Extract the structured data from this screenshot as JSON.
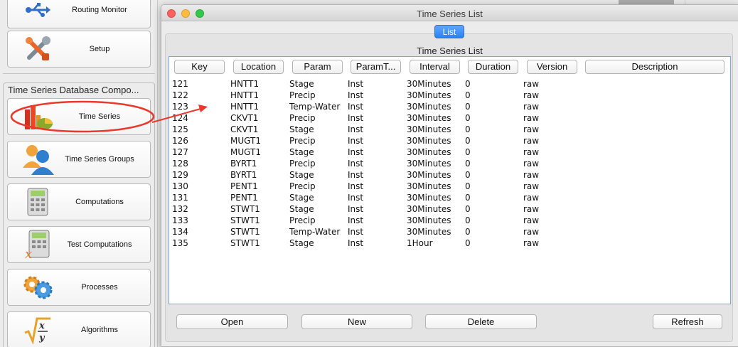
{
  "launcher": {
    "top_buttons": [
      {
        "label": "Routing Monitor",
        "icon": "usb-routing-icon"
      },
      {
        "label": "Setup",
        "icon": "tools-icon"
      }
    ],
    "group_title": "Time Series Database Compo...",
    "group_buttons": [
      {
        "label": "Time Series",
        "icon": "time-series-chart-icon"
      },
      {
        "label": "Time Series Groups",
        "icon": "users-group-icon"
      },
      {
        "label": "Computations",
        "icon": "calculator-icon"
      },
      {
        "label": "Test Computations",
        "icon": "test-calculator-icon"
      },
      {
        "label": "Processes",
        "icon": "gears-icon"
      },
      {
        "label": "Algorithms",
        "icon": "sqrt-formula-icon"
      }
    ]
  },
  "window": {
    "title": "Time Series List",
    "tab_label": "List",
    "panel_title": "Time Series List"
  },
  "table": {
    "columns": [
      "Key",
      "Location",
      "Param",
      "ParamT...",
      "Interval",
      "Duration",
      "Version",
      "Description"
    ],
    "rows": [
      [
        "121",
        "HNTT1",
        "Stage",
        "Inst",
        "30Minutes",
        "0",
        "raw",
        ""
      ],
      [
        "122",
        "HNTT1",
        "Precip",
        "Inst",
        "30Minutes",
        "0",
        "raw",
        ""
      ],
      [
        "123",
        "HNTT1",
        "Temp-Water",
        "Inst",
        "30Minutes",
        "0",
        "raw",
        ""
      ],
      [
        "124",
        "CKVT1",
        "Precip",
        "Inst",
        "30Minutes",
        "0",
        "raw",
        ""
      ],
      [
        "125",
        "CKVT1",
        "Stage",
        "Inst",
        "30Minutes",
        "0",
        "raw",
        ""
      ],
      [
        "126",
        "MUGT1",
        "Precip",
        "Inst",
        "30Minutes",
        "0",
        "raw",
        ""
      ],
      [
        "127",
        "MUGT1",
        "Stage",
        "Inst",
        "30Minutes",
        "0",
        "raw",
        ""
      ],
      [
        "128",
        "BYRT1",
        "Precip",
        "Inst",
        "30Minutes",
        "0",
        "raw",
        ""
      ],
      [
        "129",
        "BYRT1",
        "Stage",
        "Inst",
        "30Minutes",
        "0",
        "raw",
        ""
      ],
      [
        "130",
        "PENT1",
        "Precip",
        "Inst",
        "30Minutes",
        "0",
        "raw",
        ""
      ],
      [
        "131",
        "PENT1",
        "Stage",
        "Inst",
        "30Minutes",
        "0",
        "raw",
        ""
      ],
      [
        "132",
        "STWT1",
        "Stage",
        "Inst",
        "30Minutes",
        "0",
        "raw",
        ""
      ],
      [
        "133",
        "STWT1",
        "Precip",
        "Inst",
        "30Minutes",
        "0",
        "raw",
        ""
      ],
      [
        "134",
        "STWT1",
        "Temp-Water",
        "Inst",
        "30Minutes",
        "0",
        "raw",
        ""
      ],
      [
        "135",
        "STWT1",
        "Stage",
        "Inst",
        "1Hour",
        "0",
        "raw",
        ""
      ]
    ]
  },
  "actions": {
    "open": "Open",
    "new": "New",
    "delete": "Delete",
    "refresh": "Refresh"
  },
  "colors": {
    "annotation": "#e8392c",
    "tab_active": "#2e7ff2"
  }
}
